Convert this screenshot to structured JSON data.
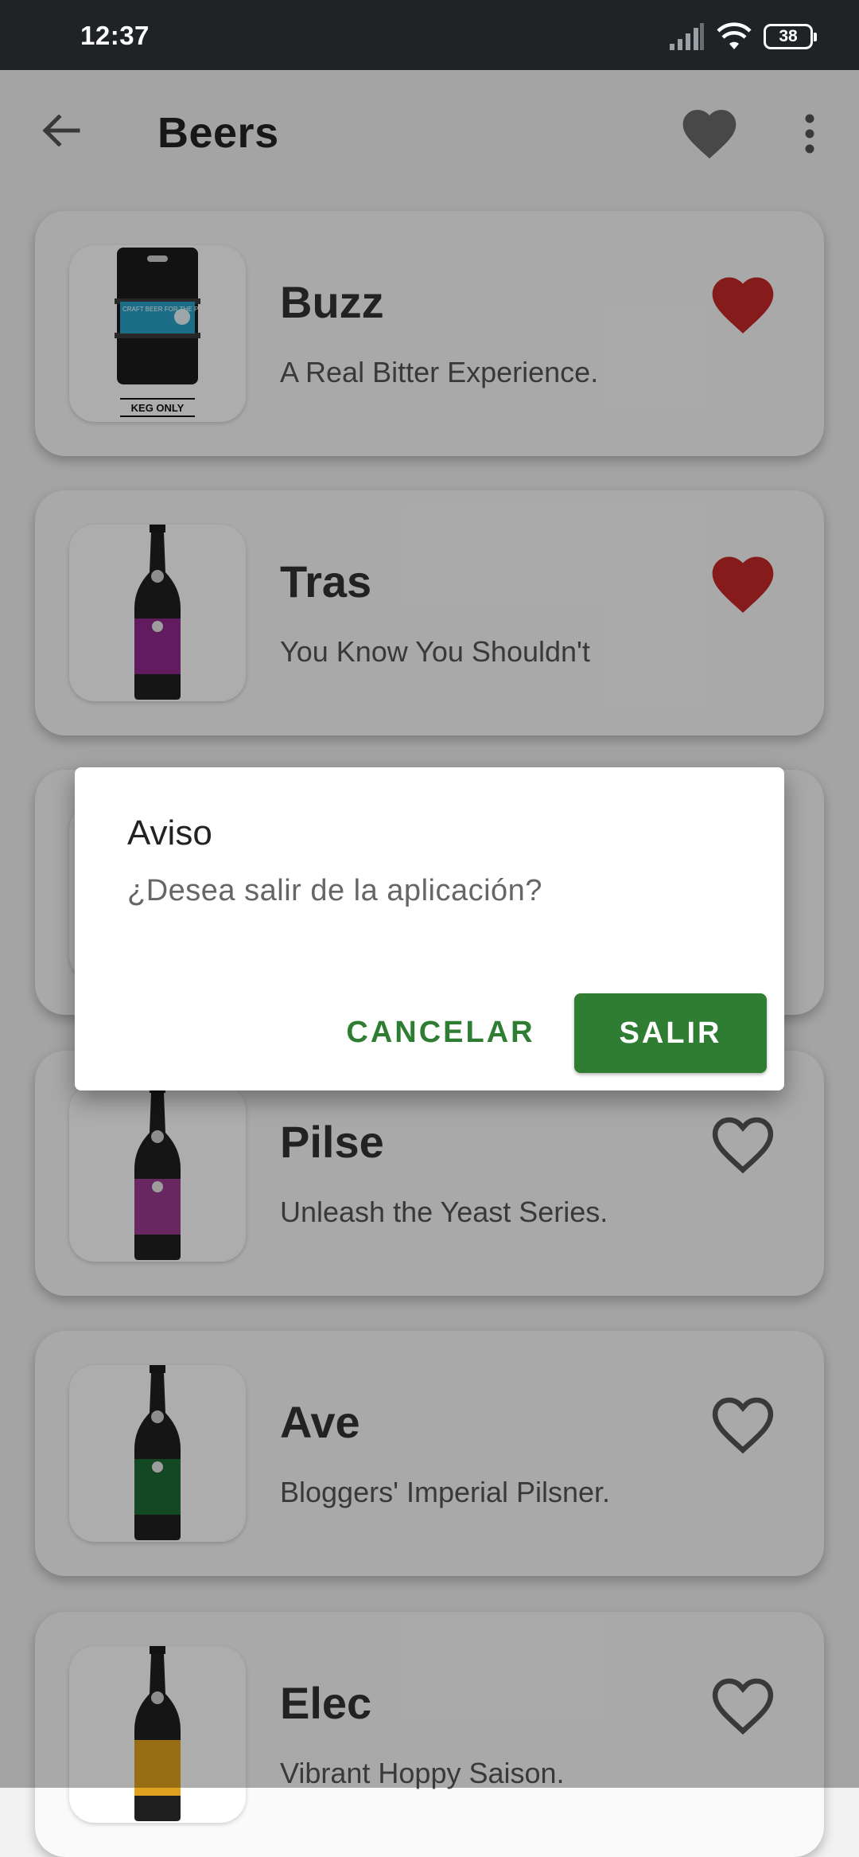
{
  "status_bar": {
    "time": "12:37",
    "battery": "38",
    "icons": [
      "signal-icon",
      "wifi-icon",
      "battery-icon"
    ]
  },
  "appbar": {
    "title": "Beers",
    "icons": [
      "back-arrow-icon",
      "favorites-heart-icon",
      "more-vert-icon"
    ]
  },
  "beers": [
    {
      "name": "Buzz",
      "tagline": "A Real Bitter Experience.",
      "favorite": true,
      "label_text": "CRAFT BEER FOR THE PEOPLE",
      "keg_text": "KEG ONLY"
    },
    {
      "name": "Tras",
      "tagline": "You Know You Shouldn't",
      "favorite": true
    },
    {
      "name": "Pilse",
      "tagline": "Unleash the Yeast Series.",
      "favorite": false
    },
    {
      "name": "Ave",
      "tagline": "Bloggers' Imperial Pilsner.",
      "favorite": false
    },
    {
      "name": "Elec",
      "tagline": "Vibrant Hoppy Saison.",
      "favorite": false
    }
  ],
  "dialog": {
    "title": "Aviso",
    "message": "¿Desea salir de la aplicación?",
    "cancel_label": "CANCELAR",
    "exit_label": "SALIR"
  },
  "colors": {
    "accent": "#2e7d32",
    "favorite": "#c62828",
    "status_bar": "#1f2326",
    "scrim": "rgba(0,0,0,0.32)"
  }
}
